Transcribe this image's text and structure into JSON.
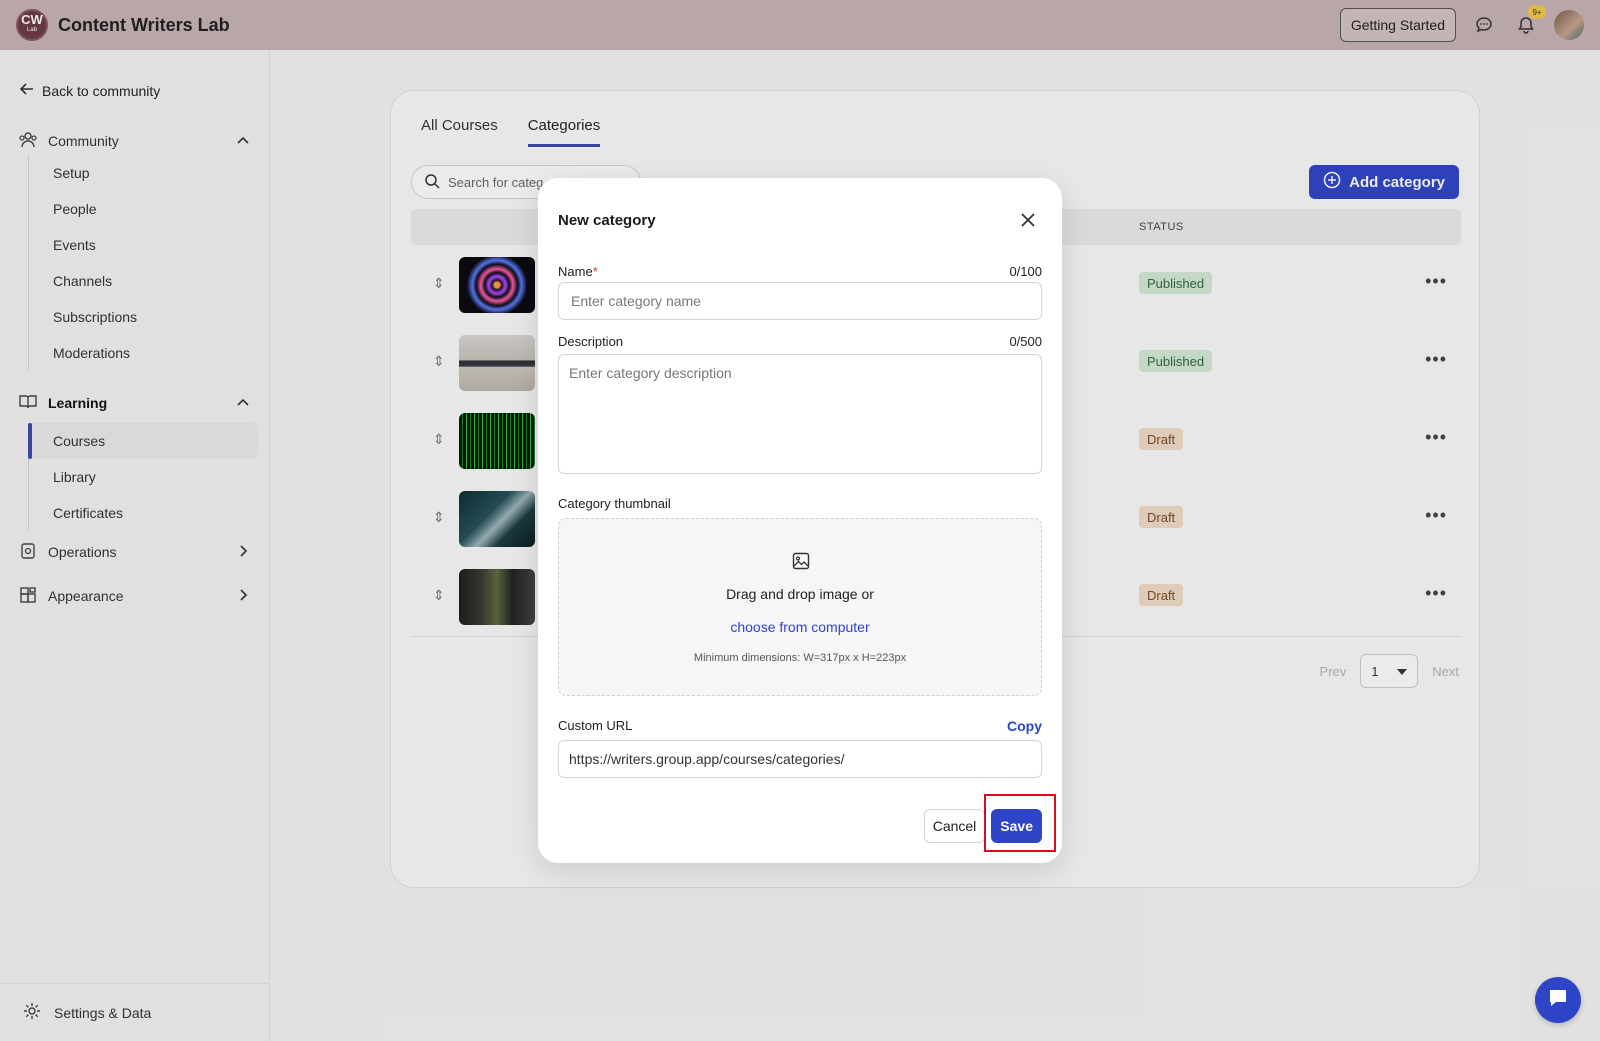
{
  "app": {
    "logo_text": "CW",
    "logo_sub": "Lab",
    "name": "Content Writers Lab"
  },
  "topbar": {
    "getting_started": "Getting Started",
    "notification_badge": "9+",
    "icons": [
      "chat-icon",
      "bell-icon",
      "avatar"
    ]
  },
  "sidebar": {
    "back_link": "Back to community",
    "community": {
      "label": "Community",
      "items": [
        "Setup",
        "People",
        "Events",
        "Channels",
        "Subscriptions",
        "Moderations"
      ]
    },
    "learning": {
      "label": "Learning",
      "items": [
        "Courses",
        "Library",
        "Certificates"
      ],
      "active": "Courses"
    },
    "operations": "Operations",
    "appearance": "Appearance",
    "footer": "Settings & Data"
  },
  "main": {
    "tabs": [
      "All Courses",
      "Categories"
    ],
    "active_tab": "Categories",
    "search_placeholder": "Search for categ...",
    "add_button": "Add category",
    "status_header": "STATUS",
    "rows": [
      {
        "status": "Published",
        "thumb": "spiral"
      },
      {
        "status": "Published",
        "thumb": "desk"
      },
      {
        "status": "Draft",
        "thumb": "matrix"
      },
      {
        "status": "Draft",
        "thumb": "studio"
      },
      {
        "status": "Draft",
        "thumb": "video"
      }
    ],
    "pager": {
      "prev": "Prev",
      "page": "1",
      "next": "Next"
    }
  },
  "modal": {
    "title": "New category",
    "name_label": "Name",
    "name_required_mark": "*",
    "name_count": "0/100",
    "name_placeholder": "Enter category name",
    "description_label": "Description",
    "description_count": "0/500",
    "description_placeholder": "Enter category description",
    "thumbnail_label": "Category thumbnail",
    "dropzone_text": "Drag and drop image or",
    "dropzone_link": "choose from computer",
    "dropzone_hint": "Minimum dimensions: W=317px x H=223px",
    "custom_url_label": "Custom URL",
    "copy_label": "Copy",
    "custom_url_value": "https://writers.group.app/courses/categories/",
    "cancel": "Cancel",
    "save": "Save"
  },
  "colors": {
    "topbar": "#c9b4b7",
    "accent": "#2f45c8",
    "highlight": "#d0101c"
  }
}
